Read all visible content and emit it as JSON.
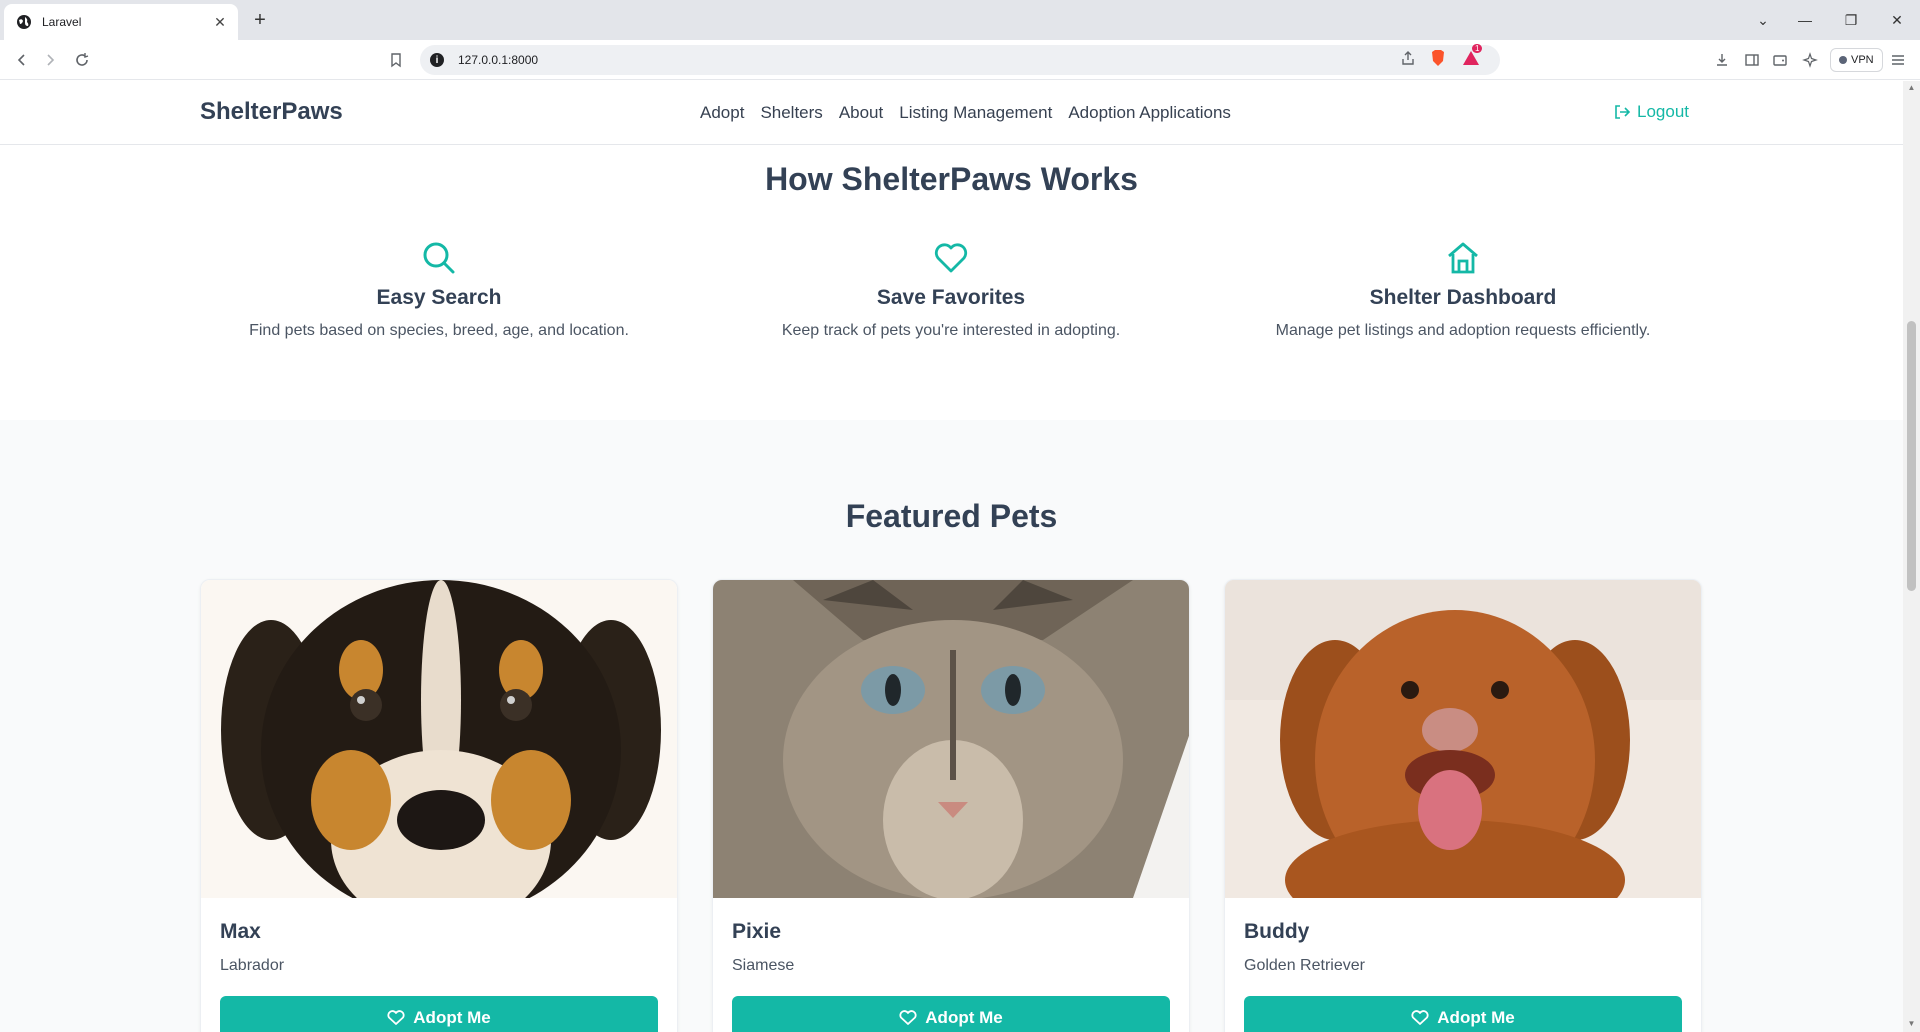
{
  "browser": {
    "tab_title": "Laravel",
    "url": "127.0.0.1:8000",
    "vpn_label": "VPN",
    "brave_badge": "1"
  },
  "nav": {
    "brand": "ShelterPaws",
    "links": [
      "Adopt",
      "Shelters",
      "About",
      "Listing Management",
      "Adoption Applications"
    ],
    "logout": "Logout"
  },
  "how": {
    "title": "How ShelterPaws Works",
    "features": [
      {
        "icon": "search-icon",
        "name": "Easy Search",
        "desc": "Find pets based on species, breed, age, and location."
      },
      {
        "icon": "heart-icon",
        "name": "Save Favorites",
        "desc": "Keep track of pets you're interested in adopting."
      },
      {
        "icon": "home-icon",
        "name": "Shelter Dashboard",
        "desc": "Manage pet listings and adoption requests efficiently."
      }
    ]
  },
  "featured": {
    "title": "Featured Pets",
    "pets": [
      {
        "name": "Max",
        "breed": "Labrador",
        "button": "Adopt Me"
      },
      {
        "name": "Pixie",
        "breed": "Siamese",
        "button": "Adopt Me"
      },
      {
        "name": "Buddy",
        "breed": "Golden Retriever",
        "button": "Adopt Me"
      }
    ]
  },
  "colors": {
    "accent": "#14b8a6",
    "heading": "#334155",
    "section_bg": "#f9fafb"
  }
}
